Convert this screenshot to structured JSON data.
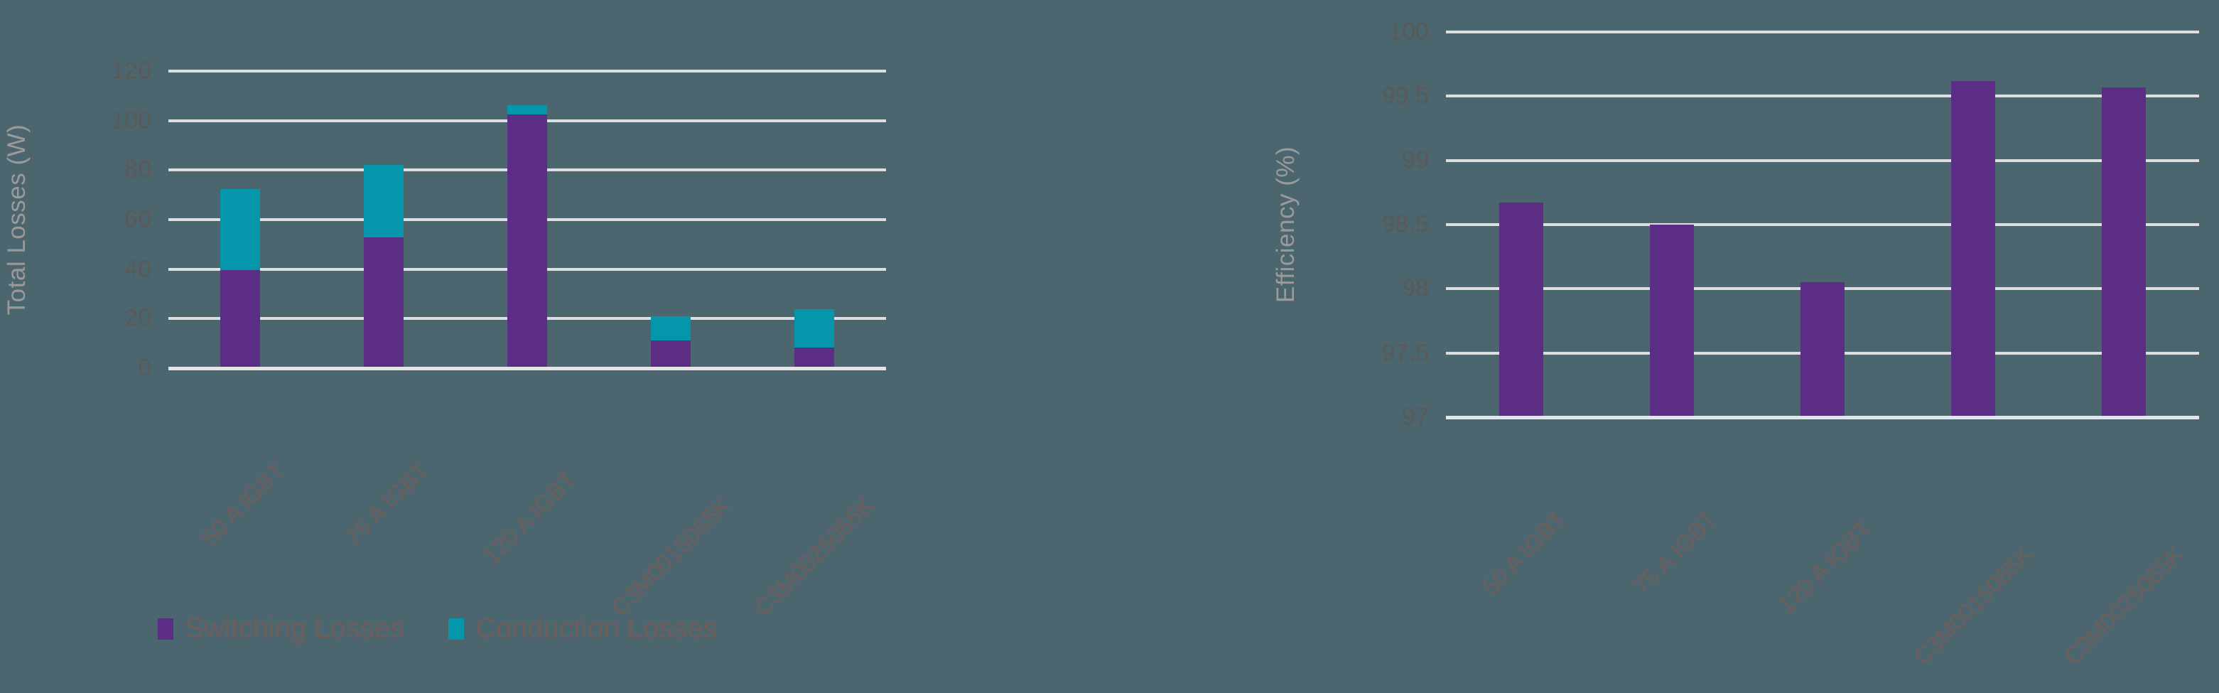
{
  "theme": {
    "background": "#4C6670",
    "gridline": "#DCDEE0",
    "tick_text": "#5A5A57",
    "axis_title": "#9A9A9A",
    "category_text": "#6D5E5B",
    "switching_color": "#5B2D85",
    "conduction_color": "#0596AB"
  },
  "legend": {
    "items": [
      {
        "label": "Switching Losses",
        "color": "#5B2D85"
      },
      {
        "label": "Conduction Losses",
        "color": "#0596AB"
      }
    ]
  },
  "chart_data": [
    {
      "type": "bar",
      "id": "total-losses",
      "title": "",
      "stacked": true,
      "xlabel": "",
      "ylabel": "Total Losses (W)",
      "ylim": [
        0,
        120
      ],
      "yticks": [
        0,
        20,
        40,
        60,
        80,
        100,
        120
      ],
      "ytick_labels": [
        "0",
        "20",
        "40",
        "60",
        "80",
        "100",
        "120"
      ],
      "grid": true,
      "legend_position": "bottom-left",
      "categories": [
        "50 A IGBT",
        "75 A IGBT",
        "120 A IGBT",
        "C3M0015065K",
        "C3M0025065K"
      ],
      "series": [
        {
          "name": "Switching Losses",
          "color": "#5B2D85",
          "values": [
            39.7,
            52.8,
            102.6,
            11.3,
            8.4
          ]
        },
        {
          "name": "Conduction Losses",
          "color": "#0596AB",
          "values": [
            32.6,
            29.2,
            3.5,
            9.7,
            15.5
          ]
        }
      ],
      "totals": [
        72.3,
        82.0,
        106.1,
        21.0,
        23.9
      ]
    },
    {
      "type": "bar",
      "id": "efficiency",
      "title": "",
      "stacked": false,
      "xlabel": "",
      "ylabel": "Efficiency (%)",
      "ylim": [
        97,
        100
      ],
      "yticks": [
        97,
        97.5,
        98,
        98.5,
        99,
        99.5,
        100
      ],
      "ytick_labels": [
        "97",
        "97.5",
        "98",
        "98.5",
        "99",
        "99.5",
        "100"
      ],
      "grid": true,
      "legend_position": "none",
      "categories": [
        "50 A IGBT",
        "75 A IGBT",
        "120 A IGBT",
        "C3M0015065K",
        "C3M0025065K"
      ],
      "series": [
        {
          "name": "Efficiency",
          "color": "#5B2D85",
          "values": [
            98.67,
            98.5,
            98.05,
            99.62,
            99.57
          ]
        }
      ]
    }
  ]
}
